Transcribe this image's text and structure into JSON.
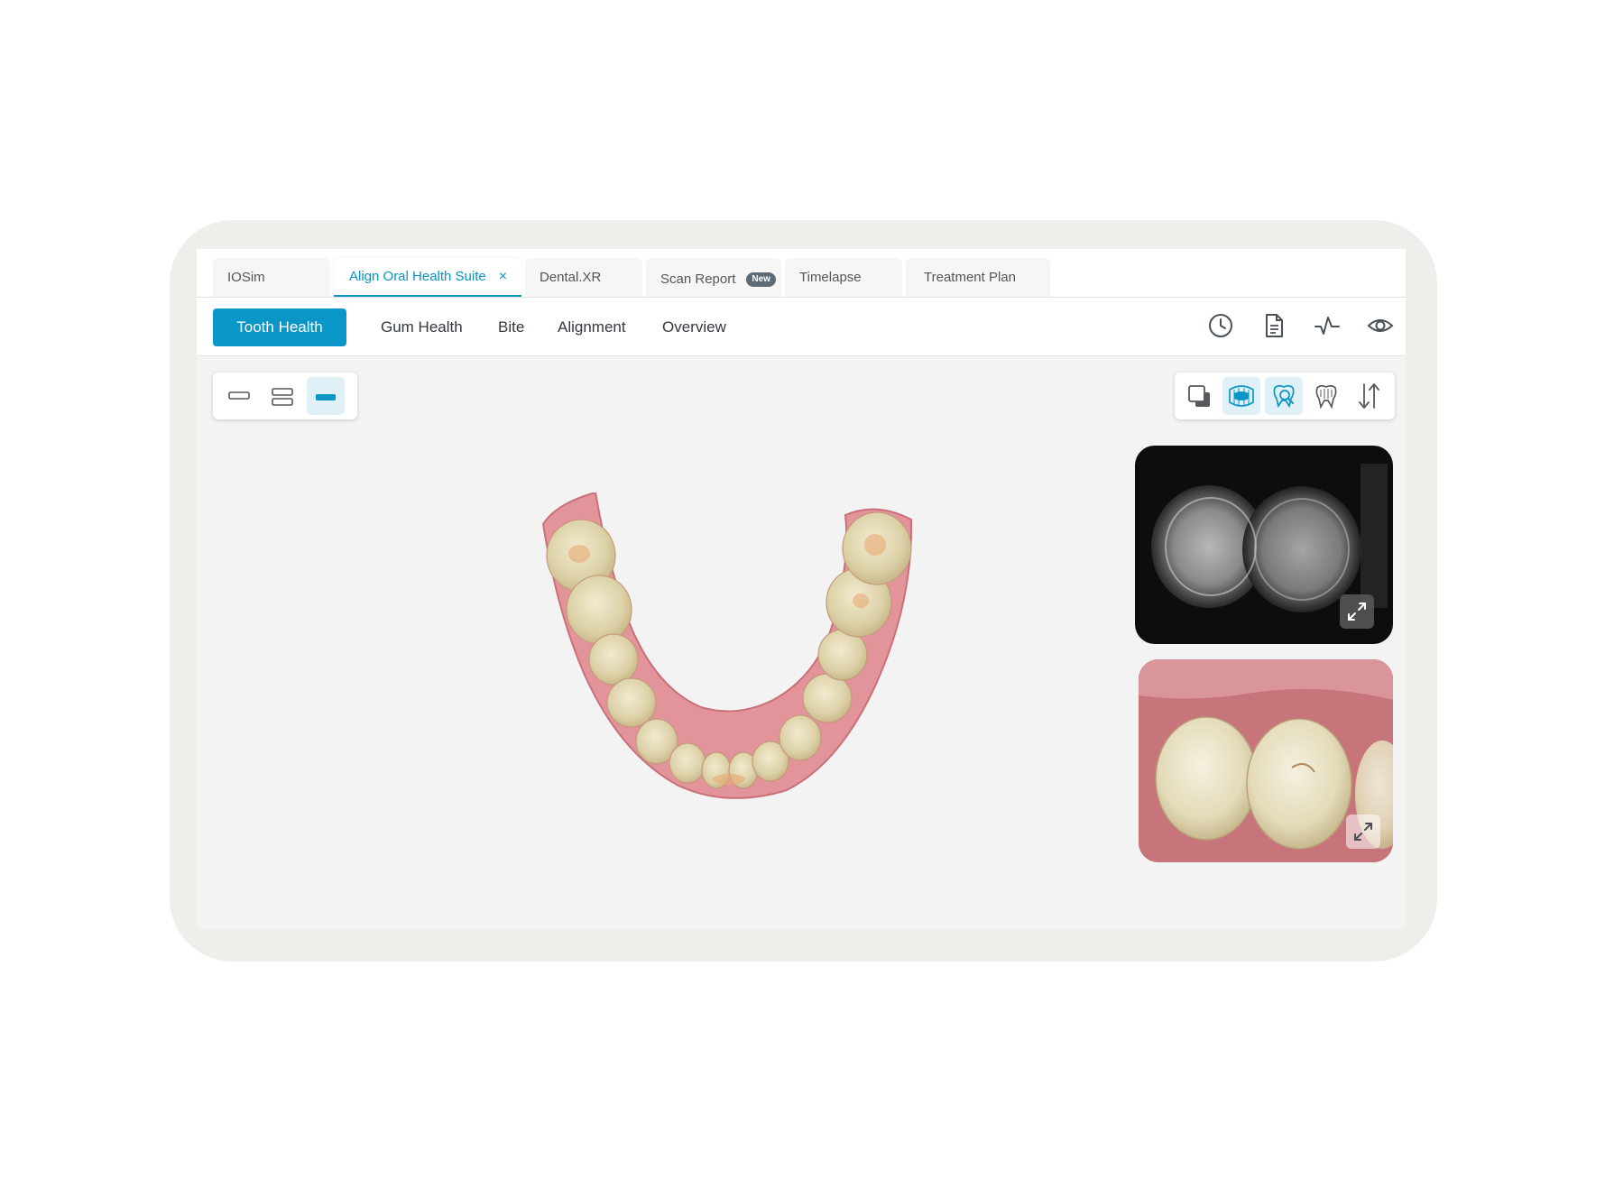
{
  "tabs": [
    {
      "label": "IOSim"
    },
    {
      "label": "Align Oral Health Suite",
      "close": "×"
    },
    {
      "label": "Dental.XR"
    },
    {
      "label": "Scan Report",
      "badge": "New"
    },
    {
      "label": "Timelapse"
    },
    {
      "label": "Treatment Plan"
    }
  ],
  "subnav": {
    "items": [
      "Tooth Health",
      "Gum Health",
      "Bite",
      "Alignment",
      "Overview"
    ],
    "icons": [
      "clock-icon",
      "document-icon",
      "pulse-icon",
      "eye-icon"
    ]
  },
  "layout_tools": {
    "icons": [
      "single-layout-icon",
      "split-layout-icon",
      "full-layout-icon"
    ],
    "selected": 2
  },
  "view_tools": {
    "icons": [
      "overlay-icon",
      "arch-view-icon",
      "tooth-search-icon",
      "tooth-icon",
      "sort-arrows-icon"
    ],
    "selected": [
      1,
      2
    ]
  },
  "viewer": {
    "model": "lower-arch-3d-scan"
  },
  "panels": [
    {
      "type": "xray-image",
      "icon": "expand-icon"
    },
    {
      "type": "intraoral-photo",
      "icon": "expand-icon"
    }
  ],
  "colors": {
    "accent": "#0b96c8",
    "selected_bg": "#dff0f7",
    "device_frame": "#efeeea",
    "viewer_bg": "#f3f3f3"
  }
}
